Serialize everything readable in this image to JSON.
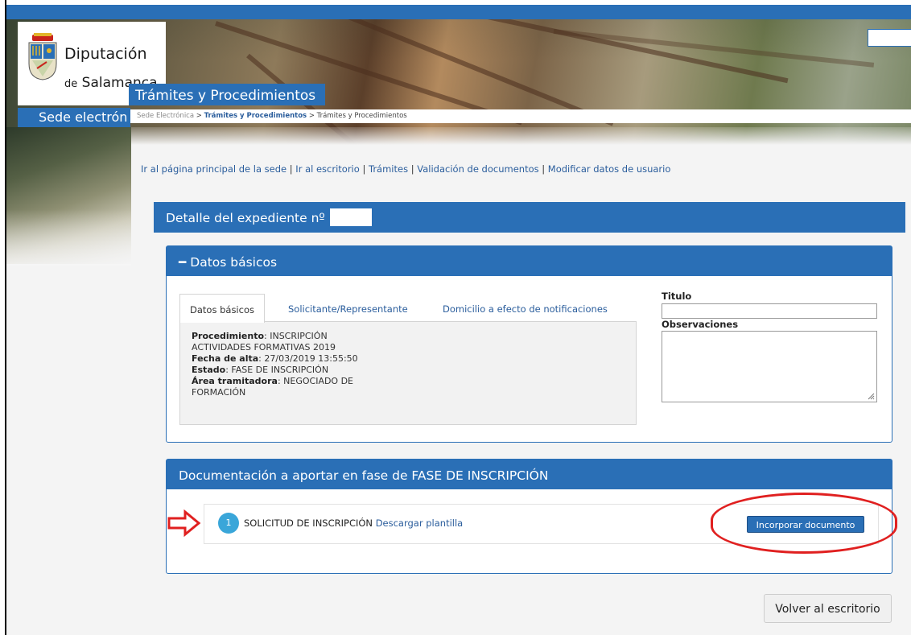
{
  "header": {
    "logo_line1": "Diputación",
    "logo_de": "de",
    "logo_line2": "Salamanca",
    "section_title": "Trámites y Procedimientos",
    "sede_label": "Sede electrón",
    "breadcrumb": {
      "home": "Sede Electrónica",
      "sep1": " > ",
      "middle": "Trámites y Procedimientos",
      "sep2": " > ",
      "current": "Trámites y Procedimientos"
    }
  },
  "quick_links": {
    "items": [
      "Ir al página principal de la sede",
      "Ir al escritorio",
      "Trámites",
      "Validación de documentos",
      "Modificar datos de usuario"
    ],
    "separator": " | "
  },
  "expediente": {
    "title": "Detalle del expediente nº"
  },
  "datos_basicos": {
    "header": "━ Datos básicos",
    "tabs": [
      "Datos básicos",
      "Solicitante/Representante",
      "Domicilio a efecto de notificaciones"
    ],
    "fields": {
      "procedimiento_label": "Procedimiento",
      "procedimiento_value": ": INSCRIPCIÓN ACTIVIDADES FORMATIVAS 2019",
      "fecha_label": "Fecha de alta",
      "fecha_value": ": 27/03/2019 13:55:50",
      "estado_label": "Estado",
      "estado_value": ": FASE DE INSCRIPCIÓN",
      "area_label": "Área tramitadora",
      "area_value": ": NEGOCIADO DE FORMACIÓN"
    },
    "titulo_label": "Titulo",
    "observaciones_label": "Observaciones"
  },
  "documentacion": {
    "header": "Documentación a aportar en fase de FASE DE INSCRIPCIÓN",
    "items": [
      {
        "number": "1",
        "name": "SOLICITUD DE INSCRIPCIÓN",
        "template_link": "Descargar plantilla",
        "button": "Incorporar documento"
      }
    ]
  },
  "footer": {
    "back_button": "Volver al escritorio"
  },
  "colors": {
    "primary_blue": "#2a6fb6",
    "link_blue": "#2a5d9c",
    "badge_blue": "#3aa6d9",
    "annotation_red": "#e02020"
  }
}
